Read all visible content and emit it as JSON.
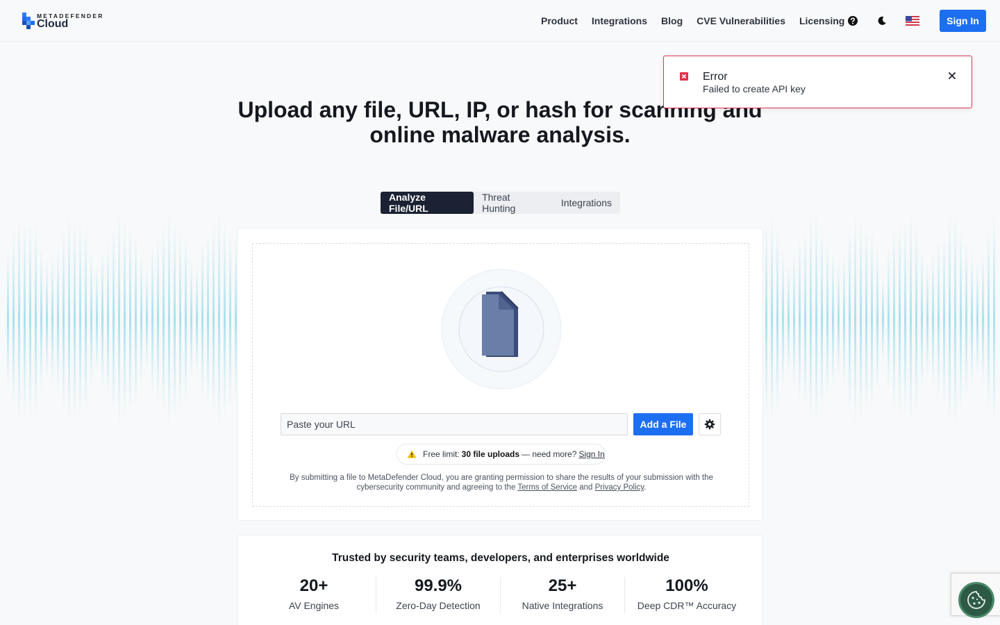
{
  "header": {
    "logo_top": "METADEFENDER",
    "logo_bottom": "Cloud",
    "nav": [
      "Product",
      "Integrations",
      "Blog",
      "CVE Vulnerabilities",
      "Licensing"
    ],
    "sign_in": "Sign In"
  },
  "hero": {
    "line1": "Upload any file, URL, IP, or hash for scanning and",
    "line2": "online malware analysis."
  },
  "tabs": [
    "Analyze File/URL",
    "Threat Hunting",
    "Integrations"
  ],
  "upload": {
    "url_placeholder": "Paste your URL",
    "add_file": "Add a File",
    "limit_prefix": "Free limit:",
    "limit_value": "30 file uploads",
    "limit_suffix": "— need more?",
    "limit_link": "Sign In",
    "consent_1": "By submitting a file to MetaDefender Cloud, you are granting permission to share the results of your submission with the cybersecurity community and agreeing to the",
    "terms": "Terms of Service",
    "and": "and",
    "privacy": "Privacy Policy",
    "period": "."
  },
  "stats": {
    "title": "Trusted by security teams, developers, and enterprises worldwide",
    "items": [
      {
        "value": "20+",
        "label": "AV Engines"
      },
      {
        "value": "99.9%",
        "label": "Zero-Day Detection"
      },
      {
        "value": "25+",
        "label": "Native Integrations"
      },
      {
        "value": "100%",
        "label": "Deep CDR™ Accuracy"
      }
    ]
  },
  "toast": {
    "title": "Error",
    "message": "Failed to create API key"
  },
  "colors": {
    "primary": "#1d6ff2",
    "dark_tab": "#1a2233",
    "error": "#e1324d",
    "wave": "#8fd8ea"
  }
}
